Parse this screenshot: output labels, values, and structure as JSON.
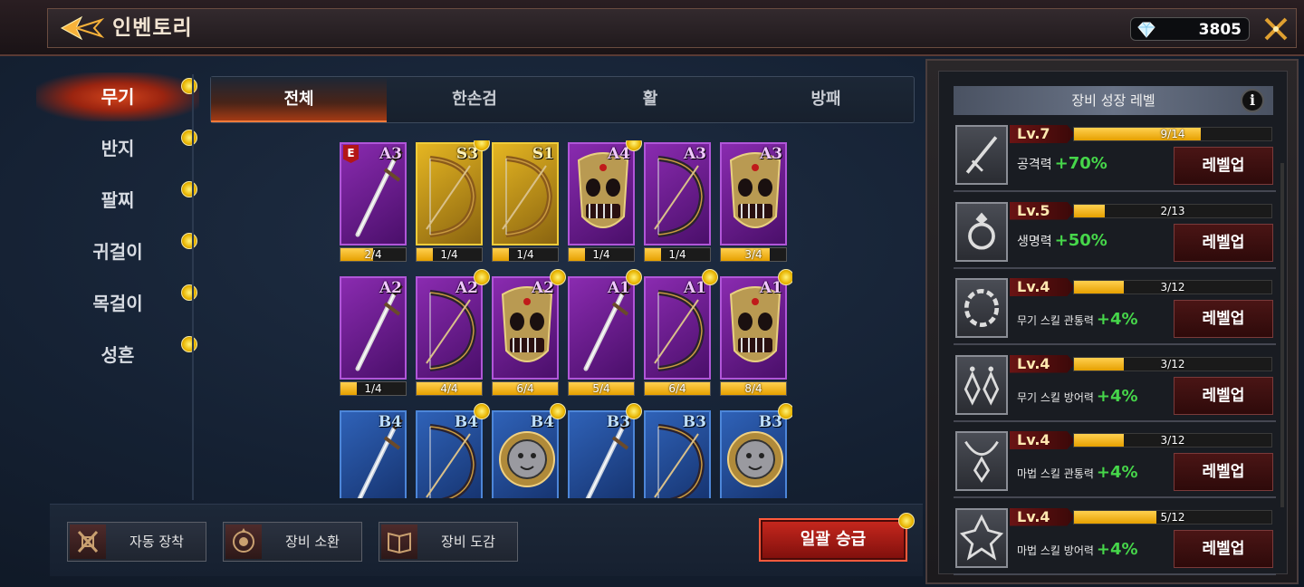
{
  "header": {
    "title": "인벤토리",
    "back_icon": "back-arrow-icon",
    "currency": {
      "icon": "diamond-icon",
      "value": "3805"
    },
    "tools_icon": "crossed-tools-icon"
  },
  "sidebar": {
    "items": [
      {
        "label": "무기",
        "active": true,
        "dot": true
      },
      {
        "label": "반지",
        "active": false,
        "dot": true
      },
      {
        "label": "팔찌",
        "active": false,
        "dot": true
      },
      {
        "label": "귀걸이",
        "active": false,
        "dot": true
      },
      {
        "label": "목걸이",
        "active": false,
        "dot": true
      },
      {
        "label": "성흔",
        "active": false,
        "dot": true
      }
    ]
  },
  "tabs": [
    {
      "label": "전체",
      "active": true
    },
    {
      "label": "한손검",
      "active": false
    },
    {
      "label": "활",
      "active": false
    },
    {
      "label": "방패",
      "active": false
    }
  ],
  "items": [
    {
      "grade": "A3",
      "type": "sword",
      "count": "2/4",
      "progress": 0.5,
      "equipped": true,
      "equipped_label": "E",
      "dot": false
    },
    {
      "grade": "S3",
      "type": "bow",
      "count": "1/4",
      "progress": 0.25,
      "equipped": false,
      "dot": true
    },
    {
      "grade": "S1",
      "type": "bow",
      "count": "1/4",
      "progress": 0.25,
      "equipped": false,
      "dot": false
    },
    {
      "grade": "A4",
      "type": "shield",
      "count": "1/4",
      "progress": 0.25,
      "equipped": false,
      "dot": true
    },
    {
      "grade": "A3",
      "type": "bow",
      "count": "1/4",
      "progress": 0.25,
      "equipped": false,
      "dot": false
    },
    {
      "grade": "A3",
      "type": "shield",
      "count": "3/4",
      "progress": 0.75,
      "equipped": false,
      "dot": false
    },
    {
      "grade": "A2",
      "type": "sword",
      "count": "1/4",
      "progress": 0.25,
      "equipped": false,
      "dot": false
    },
    {
      "grade": "A2",
      "type": "bow",
      "count": "4/4",
      "progress": 1.0,
      "equipped": false,
      "dot": true
    },
    {
      "grade": "A2",
      "type": "shield",
      "count": "6/4",
      "progress": 1.0,
      "equipped": false,
      "dot": true
    },
    {
      "grade": "A1",
      "type": "sword",
      "count": "5/4",
      "progress": 1.0,
      "equipped": false,
      "dot": true
    },
    {
      "grade": "A1",
      "type": "bow",
      "count": "6/4",
      "progress": 1.0,
      "equipped": false,
      "dot": true
    },
    {
      "grade": "A1",
      "type": "shield",
      "count": "8/4",
      "progress": 1.0,
      "equipped": false,
      "dot": true
    },
    {
      "grade": "B4",
      "type": "sword",
      "count": "",
      "progress": 0,
      "equipped": false,
      "dot": false
    },
    {
      "grade": "B4",
      "type": "bow",
      "count": "",
      "progress": 0,
      "equipped": false,
      "dot": true
    },
    {
      "grade": "B4",
      "type": "round-shield",
      "count": "",
      "progress": 0,
      "equipped": false,
      "dot": true
    },
    {
      "grade": "B3",
      "type": "sword",
      "count": "",
      "progress": 0,
      "equipped": false,
      "dot": true
    },
    {
      "grade": "B3",
      "type": "bow",
      "count": "",
      "progress": 0,
      "equipped": false,
      "dot": false
    },
    {
      "grade": "B3",
      "type": "round-shield",
      "count": "",
      "progress": 0,
      "equipped": false,
      "dot": true
    }
  ],
  "bottom": {
    "buttons": [
      {
        "label": "자동 장착",
        "icon": "auto-equip-icon"
      },
      {
        "label": "장비 소환",
        "icon": "summon-icon"
      },
      {
        "label": "장비 도감",
        "icon": "codex-book-icon"
      }
    ],
    "upgrade_all": {
      "label": "일괄 승급",
      "dot": true
    }
  },
  "growth": {
    "title": "장비 성장 레벨",
    "info_icon": "info-icon",
    "info_glyph": "i",
    "rows": [
      {
        "icon": "sword-icon",
        "level": "Lv.7",
        "xp": "9/14",
        "progress": 0.643,
        "stat": "공격력",
        "bonus": "+70%",
        "button": "레벨업",
        "small": false
      },
      {
        "icon": "ring-icon",
        "level": "Lv.5",
        "xp": "2/13",
        "progress": 0.154,
        "stat": "생명력",
        "bonus": "+50%",
        "button": "레벨업",
        "small": false
      },
      {
        "icon": "bracelet-icon",
        "level": "Lv.4",
        "xp": "3/12",
        "progress": 0.25,
        "stat": "무기 스킬 관통력",
        "bonus": "+4%",
        "button": "레벨업",
        "small": true
      },
      {
        "icon": "earring-icon",
        "level": "Lv.4",
        "xp": "3/12",
        "progress": 0.25,
        "stat": "무기 스킬 방어력",
        "bonus": "+4%",
        "button": "레벨업",
        "small": true
      },
      {
        "icon": "necklace-icon",
        "level": "Lv.4",
        "xp": "3/12",
        "progress": 0.25,
        "stat": "마법 스킬 관통력",
        "bonus": "+4%",
        "button": "레벨업",
        "small": true
      },
      {
        "icon": "stigma-icon",
        "level": "Lv.4",
        "xp": "5/12",
        "progress": 0.417,
        "stat": "마법 스킬 방어력",
        "bonus": "+4%",
        "button": "레벨업",
        "small": true
      }
    ]
  }
}
